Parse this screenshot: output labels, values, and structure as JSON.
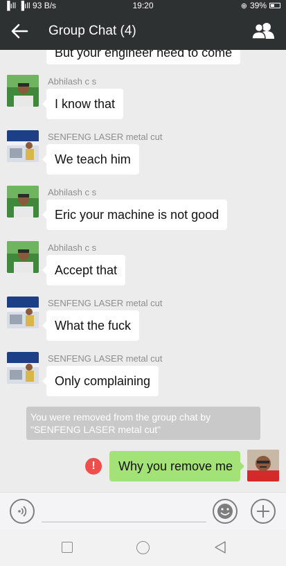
{
  "status_bar": {
    "signal": "▐ıll ▐ıll",
    "speed": "93 B/s",
    "time": "19:20",
    "battery": "39%"
  },
  "header": {
    "title": "Group Chat (4)",
    "back_icon": "arrow-left-icon",
    "members_icon": "group-members-icon"
  },
  "chat": {
    "cut_off_message": "But your engineer need to come",
    "messages": [
      {
        "sender": "Abhilash c s",
        "text": "I know that",
        "avatar": "abhilash"
      },
      {
        "sender": "SENFENG LASER metal cut",
        "text": "We teach him",
        "avatar": "senfeng"
      },
      {
        "sender": "Abhilash c s",
        "text": "Eric your machine is not good",
        "avatar": "abhilash"
      },
      {
        "sender": "Abhilash c s",
        "text": "Accept that",
        "avatar": "abhilash"
      },
      {
        "sender": "SENFENG LASER metal cut",
        "text": "What the fuck",
        "avatar": "senfeng"
      },
      {
        "sender": "SENFENG LASER metal cut",
        "text": "Only complaining",
        "avatar": "senfeng"
      }
    ],
    "system_message": "You were removed from the group chat by \"SENFENG LASER metal cut\"",
    "own_message": {
      "text": "Why you remove me",
      "status_icon": "error-icon",
      "status_glyph": "!"
    }
  },
  "input_bar": {
    "voice_icon": "voice-icon",
    "emoji_icon": "emoji-icon",
    "plus_icon": "plus-icon"
  },
  "nav_bar": {
    "recents_icon": "square-icon",
    "home_icon": "circle-icon",
    "back_icon": "triangle-back-icon"
  },
  "colors": {
    "header_bg": "#2e3132",
    "chat_bg": "#ececec",
    "own_bubble": "#a3e276",
    "error": "#f04d4d"
  }
}
